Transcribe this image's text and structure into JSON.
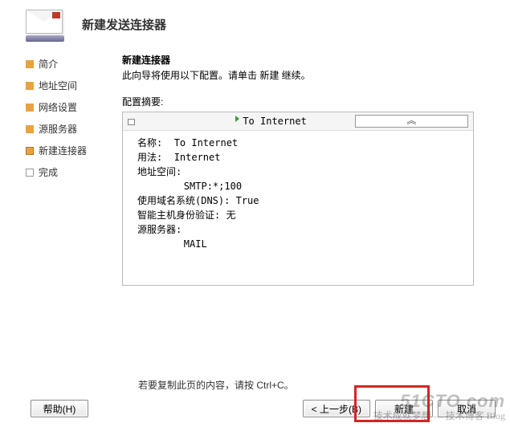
{
  "header": {
    "title": "新建发送连接器"
  },
  "sidebar": {
    "items": [
      {
        "label": "简介",
        "state": "done"
      },
      {
        "label": "地址空间",
        "state": "done"
      },
      {
        "label": "网络设置",
        "state": "done"
      },
      {
        "label": "源服务器",
        "state": "done"
      },
      {
        "label": "新建连接器",
        "state": "cur"
      },
      {
        "label": "完成",
        "state": "todo"
      }
    ]
  },
  "content": {
    "title": "新建连接器",
    "desc": "此向导将使用以下配置。请单击 新建 继续。",
    "summary_label": "配置摘要:",
    "summary_head": "To Internet",
    "config": {
      "name_label": "名称:",
      "name_value": "To Internet",
      "usage_label": "用法:",
      "usage_value": "Internet",
      "addr_label": "地址空间:",
      "addr_value": "SMTP:*;100",
      "dns_label": "使用域名系统(DNS):",
      "dns_value": "True",
      "smart_label": "智能主机身份验证:",
      "smart_value": "无",
      "src_label": "源服务器:",
      "src_value": "MAIL"
    },
    "copy_hint": "若要复制此页的内容，请按 Ctrl+C。"
  },
  "buttons": {
    "help": "帮助(H)",
    "back": "< 上一步(B)",
    "create": "新建",
    "cancel": "取消"
  },
  "watermark": {
    "line1": "51CTO.com",
    "line2": "技术成就梦想 — 技术博客 Blog"
  }
}
